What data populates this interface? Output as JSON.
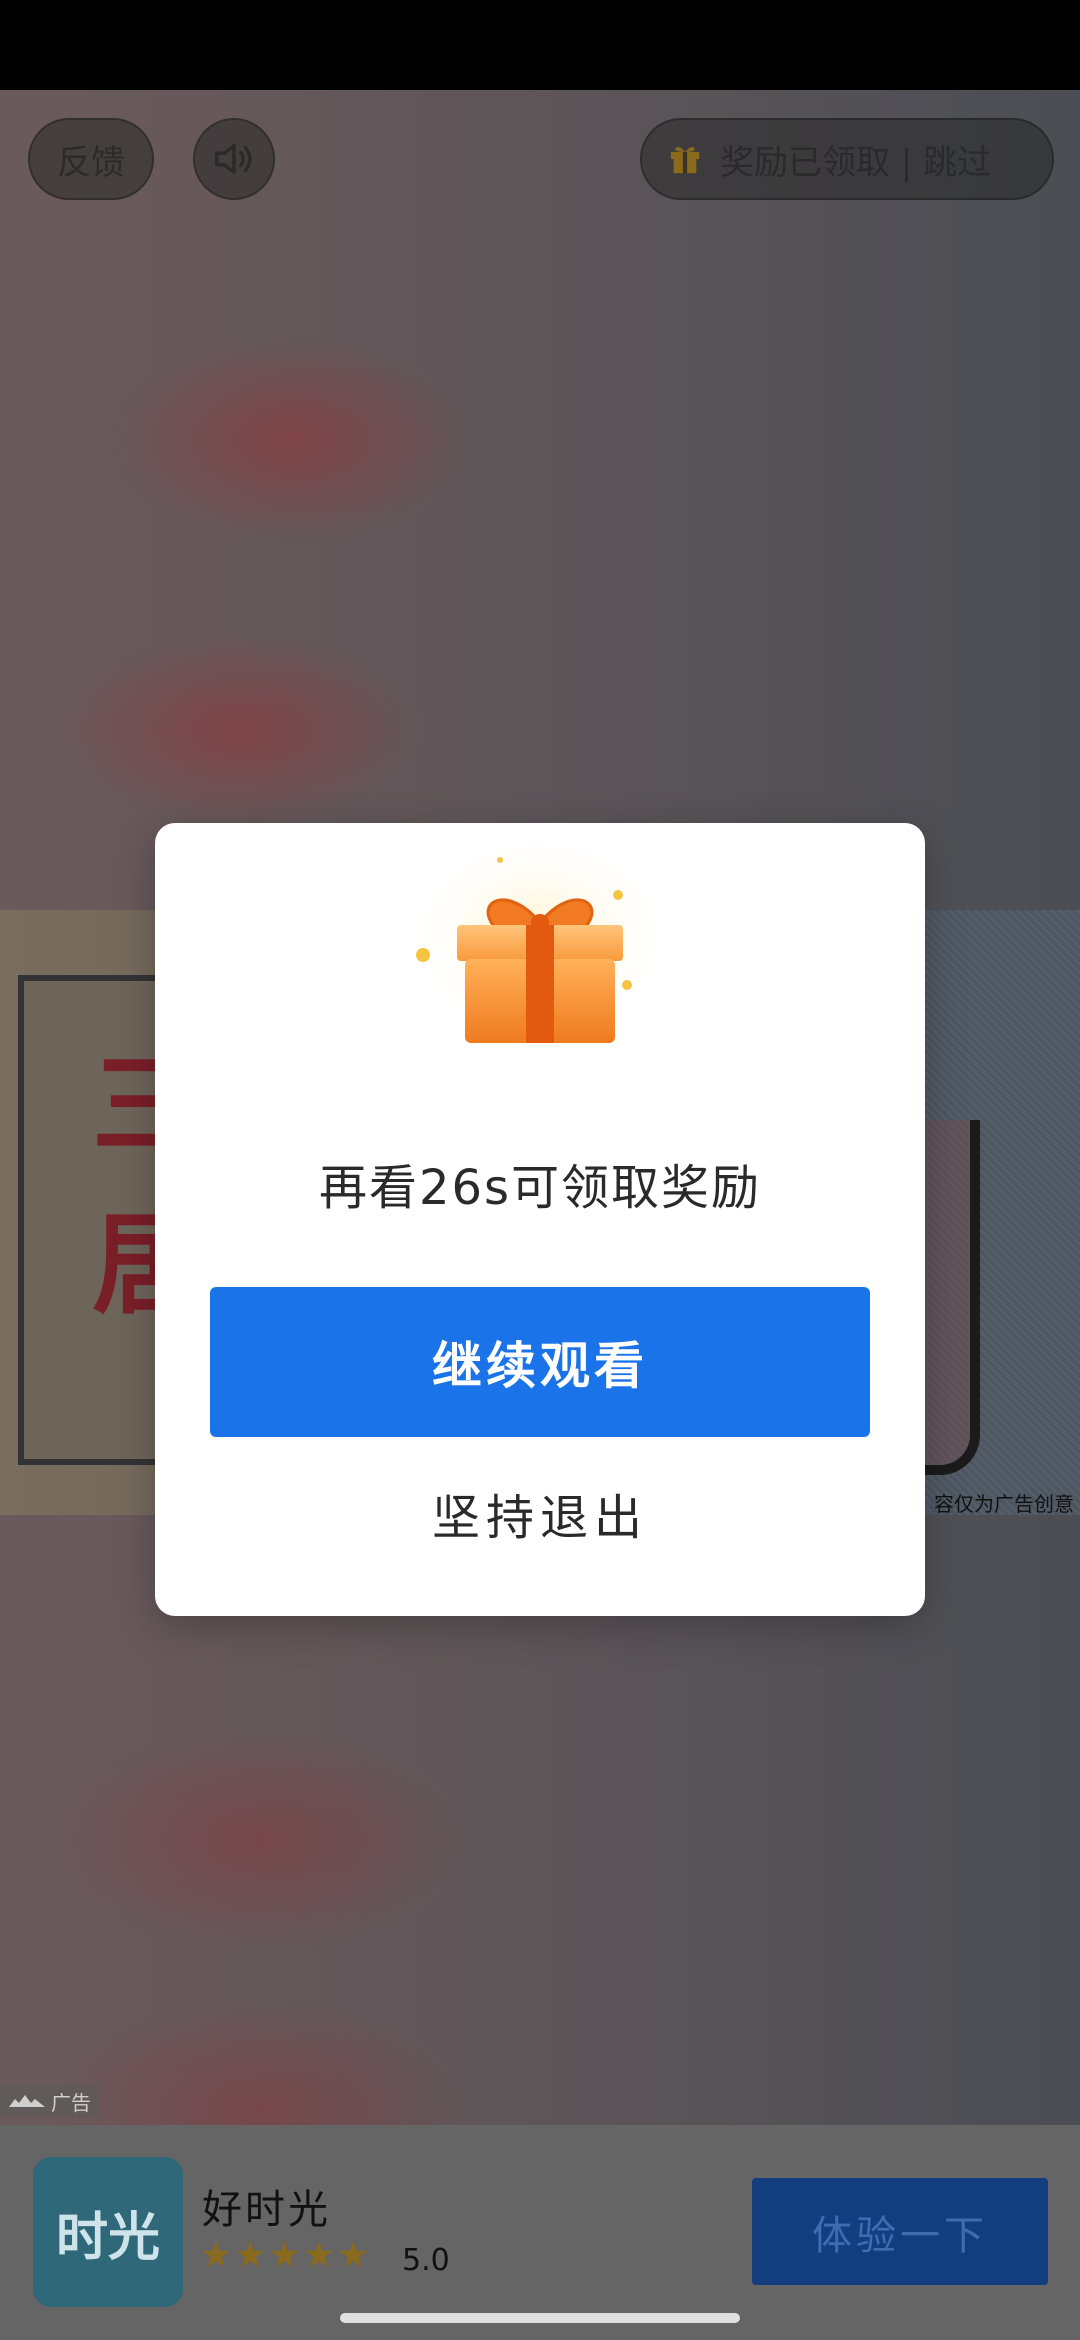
{
  "top_controls": {
    "feedback_label": "反馈",
    "reward_skip_label": "奖励已领取 | 跳过"
  },
  "ad_creative": {
    "stamp_text_1": "三",
    "stamp_text_2": "居",
    "disclaimer": "容仅为广告创意"
  },
  "dialog": {
    "message": "再看26s可领取奖励",
    "continue_label": "继续观看",
    "exit_label": "坚持退出"
  },
  "ad_tag": {
    "label": "广告"
  },
  "app_bar": {
    "icon_text": "时光",
    "app_name": "好时光",
    "rating_stars": "★★★★★",
    "rating_value": "5.0",
    "cta_label": "体验一下"
  },
  "colors": {
    "primary_button": "#1a73e8",
    "cta_button": "#123e80",
    "gift_orange": "#f7931e"
  }
}
